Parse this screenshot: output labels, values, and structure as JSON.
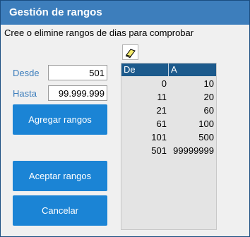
{
  "title": "Gestión de rangos",
  "instructions": "Cree o elimine rangos de dias para comprobar",
  "form": {
    "desde_label": "Desde",
    "desde_value": "501",
    "hasta_label": "Hasta",
    "hasta_value": "99.999.999"
  },
  "buttons": {
    "add": "Agregar rangos",
    "accept": "Aceptar rangos",
    "cancel": "Cancelar"
  },
  "icons": {
    "eraser": "eraser-icon"
  },
  "colors": {
    "titlebar": "#3d7ebc",
    "button": "#1b84d5",
    "table_header": "#1c5a8c",
    "label": "#3d7ebc"
  },
  "table": {
    "columns": [
      "De",
      "A"
    ],
    "rows": [
      {
        "de": "0",
        "a": "10"
      },
      {
        "de": "11",
        "a": "20"
      },
      {
        "de": "21",
        "a": "60"
      },
      {
        "de": "61",
        "a": "100"
      },
      {
        "de": "101",
        "a": "500"
      },
      {
        "de": "501",
        "a": "99999999"
      }
    ]
  }
}
